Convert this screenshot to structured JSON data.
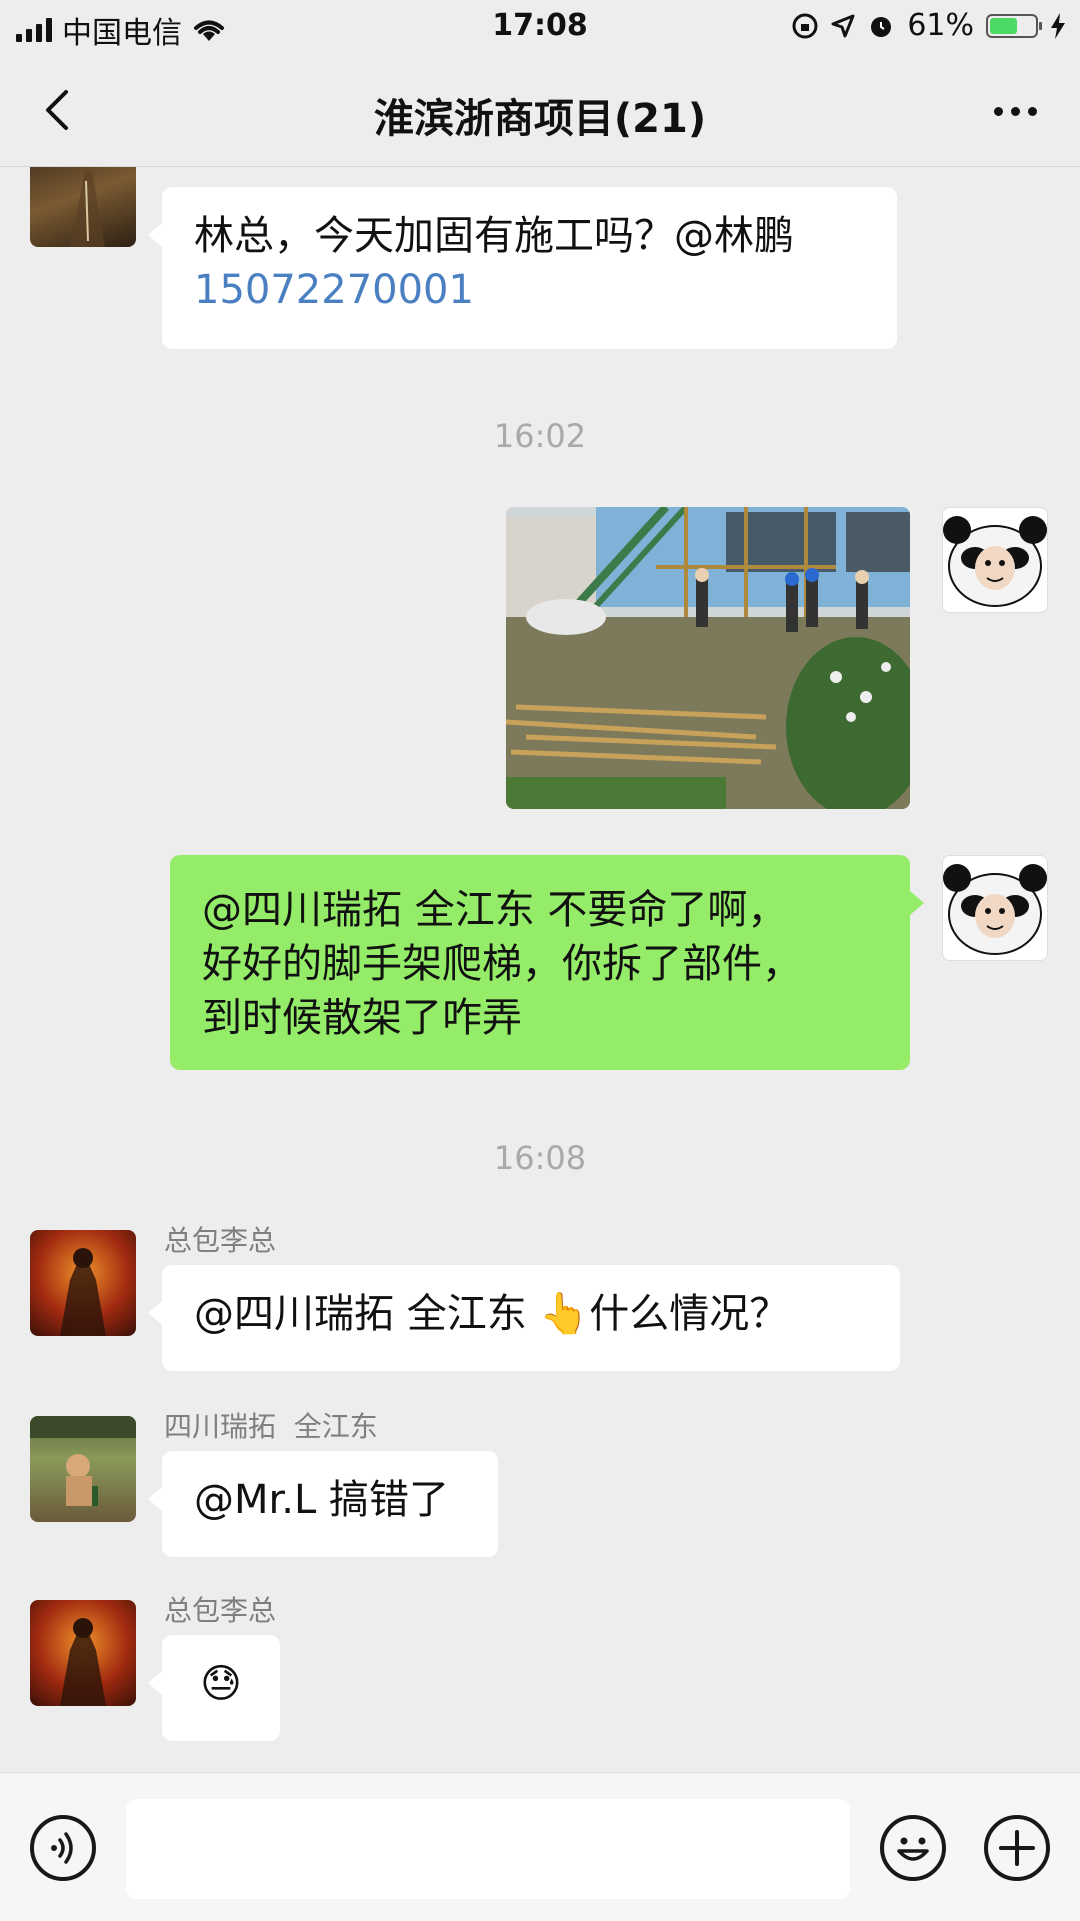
{
  "status_bar": {
    "carrier": "中国电信",
    "time": "17:08",
    "battery_percent": "61%",
    "battery_level": 0.61,
    "accent_battery_color": "#4cd964"
  },
  "nav": {
    "title": "淮滨浙商项目(21)",
    "back_icon": "chevron-left-icon",
    "more_icon": "more-dots-icon"
  },
  "messages": [
    {
      "side": "left",
      "sender": "",
      "text": "林总，今天加固有施工吗？@林鹏",
      "text_link": "15072270001"
    },
    {
      "type": "timestamp",
      "text": "16:02"
    },
    {
      "side": "right",
      "type": "image"
    },
    {
      "side": "right",
      "lines": [
        "@四川瑞拓  全江东 不要命了啊，",
        "好好的脚手架爬梯，你拆了部件，",
        "到时候散架了咋弄"
      ]
    },
    {
      "type": "timestamp",
      "text": "16:08"
    },
    {
      "side": "left",
      "sender": "总包李总",
      "text": "@四川瑞拓  全江东 👆什么情况？"
    },
    {
      "side": "left",
      "sender": "四川瑞拓  全江东",
      "text": "@Mr.L 搞错了"
    },
    {
      "side": "left",
      "sender": "总包李总",
      "text": "😓"
    }
  ],
  "input_bar": {
    "voice_icon": "voice-icon",
    "emoji_icon": "emoji-icon",
    "plus_icon": "plus-icon",
    "placeholder": ""
  },
  "colors": {
    "background": "#ededed",
    "outgoing_bubble": "#95ec69",
    "incoming_bubble": "#ffffff",
    "link": "#4a7fc1"
  }
}
